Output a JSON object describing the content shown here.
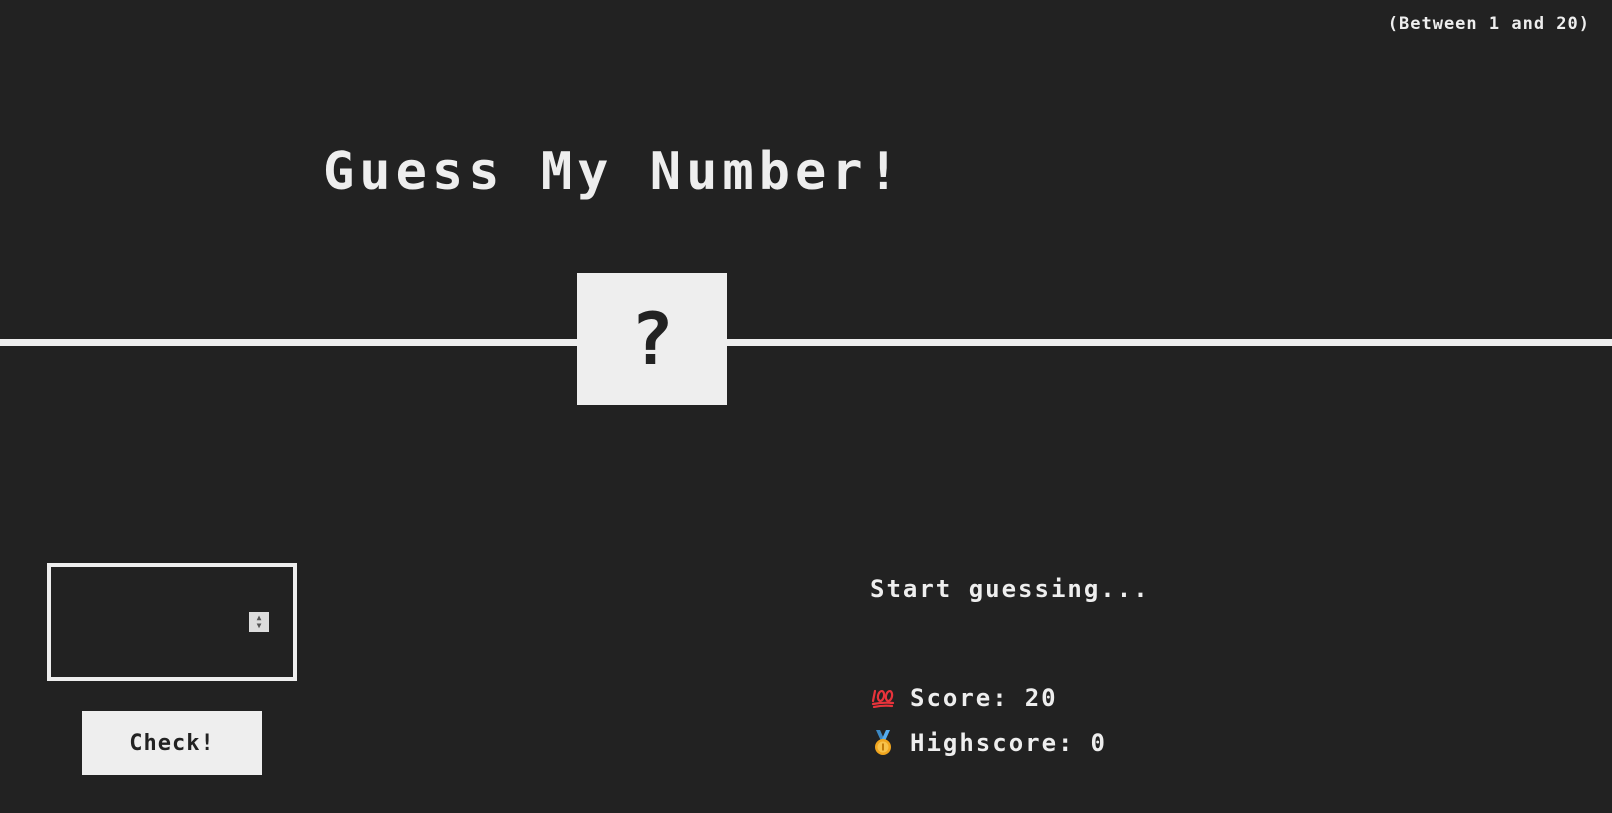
{
  "header": {
    "range_hint": "(Between 1 and 20)",
    "title": "Guess My Number!"
  },
  "secret": {
    "display": "?"
  },
  "controls": {
    "guess_value": "",
    "check_label": "Check!"
  },
  "status": {
    "message": "Start guessing...",
    "score_label": "Score:",
    "score_value": "20",
    "score_icon": "hundred-points-icon",
    "highscore_label": "Highscore:",
    "highscore_value": "0",
    "highscore_icon": "medal-icon"
  },
  "colors": {
    "background": "#222222",
    "foreground": "#eeeeee",
    "score_icon_red": "#e8333b",
    "medal_gold": "#f0a51e",
    "medal_ribbon": "#3b88c3"
  }
}
